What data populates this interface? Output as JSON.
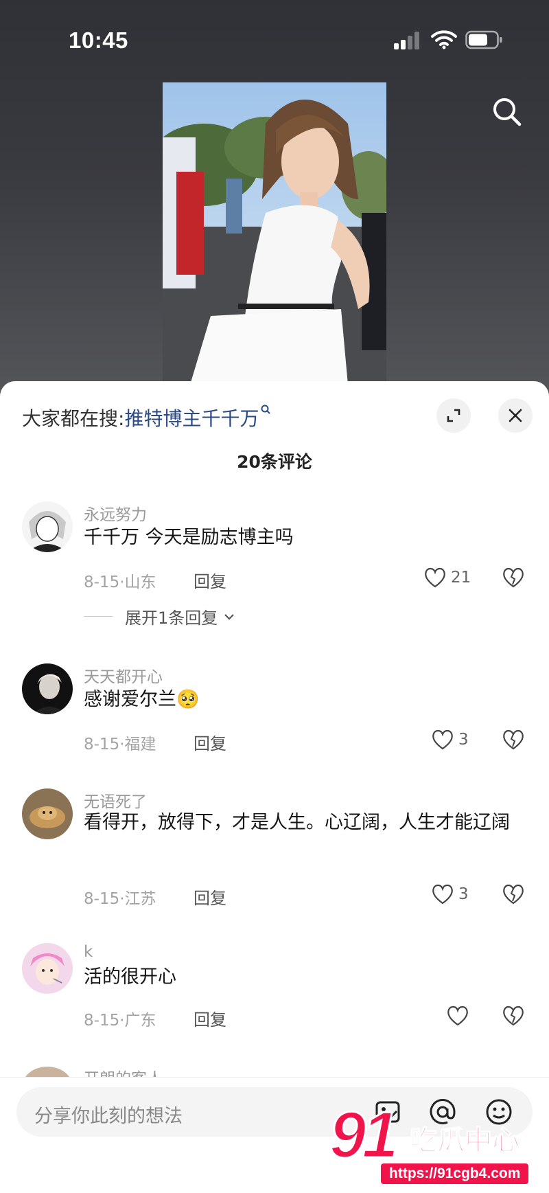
{
  "status_bar": {
    "time": "10:45"
  },
  "hot_search": {
    "prefix": "大家都在搜:",
    "term": "推特博主千千万"
  },
  "comment_count": "20条评论",
  "comments": [
    {
      "username": "永远努力",
      "text": "千千万 今天是励志博主吗",
      "date_loc": "8-15·山东",
      "reply": "回复",
      "likes": "21",
      "expand": "展开1条回复"
    },
    {
      "username": "天天都开心",
      "text": "感谢爱尔兰🥺",
      "date_loc": "8-15·福建",
      "reply": "回复",
      "likes": "3"
    },
    {
      "username": "无语死了",
      "text": "看得开，放得下，才是人生。心辽阔，人生才能辽阔",
      "date_loc": "8-15·江苏",
      "reply": "回复",
      "likes": "3"
    },
    {
      "username": "k",
      "text": "活的很开心",
      "date_loc": "8-15·广东",
      "reply": "回复",
      "likes": ""
    },
    {
      "username": "开朗的客人"
    }
  ],
  "input": {
    "placeholder": "分享你此刻的想法"
  },
  "watermark": {
    "number": "91",
    "name": "吃瓜中心",
    "url": "https://91cgb4.com"
  },
  "colors": {
    "link": "#2a4a86",
    "watermark": "#f0144a"
  }
}
